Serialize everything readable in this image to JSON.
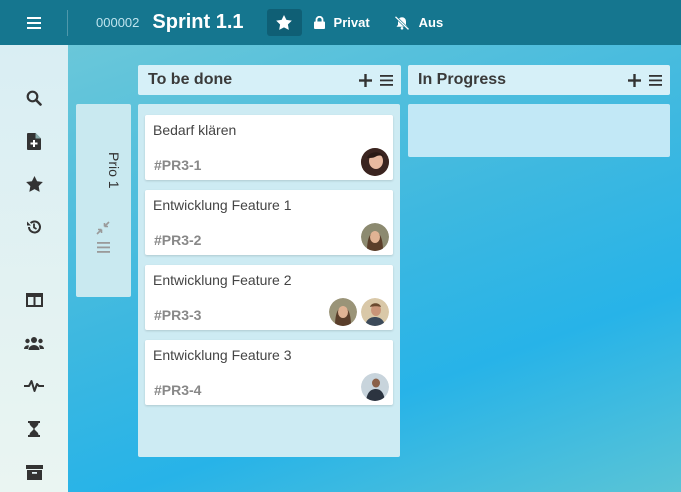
{
  "topbar": {
    "menu_icon": "hamburger-icon",
    "board_id": "000002",
    "board_title": "Sprint 1.1",
    "star_icon": "star-icon",
    "visibility_label": "Privat",
    "visibility_icon": "lock-icon",
    "notifications_label": "Aus",
    "notifications_icon": "bell-off-icon"
  },
  "sidebar": {
    "icons": [
      "search-icon",
      "new-document-icon",
      "star-icon",
      "history-icon",
      "columns-icon",
      "team-icon",
      "activity-icon",
      "hourglass-icon",
      "archive-icon"
    ]
  },
  "swimlane": {
    "title": "Prio 1",
    "collapse_icon": "compress-icon",
    "menu_icon": "hamburger-icon"
  },
  "columns": [
    {
      "title": "To be done",
      "add_icon": "plus-icon",
      "menu_icon": "hamburger-icon",
      "cards": [
        {
          "title": "Bedarf klären",
          "id": "#PR3-1"
        },
        {
          "title": "Entwicklung Feature 1",
          "id": "#PR3-2"
        },
        {
          "title": "Entwicklung Feature 2",
          "id": "#PR3-3"
        },
        {
          "title": "Entwicklung Feature 3",
          "id": "#PR3-4"
        }
      ]
    },
    {
      "title": "In Progress",
      "add_icon": "plus-icon",
      "menu_icon": "hamburger-icon",
      "cards": []
    }
  ],
  "colors": {
    "topbar": "#15768f",
    "accent": "#27b3e8"
  }
}
